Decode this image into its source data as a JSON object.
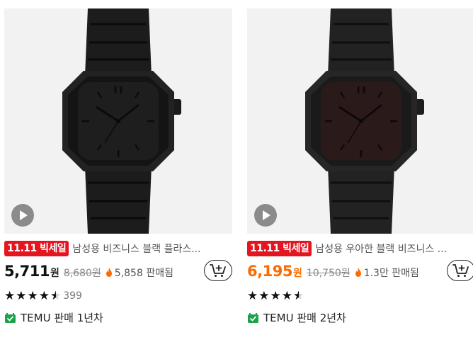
{
  "products": [
    {
      "badge": "11.11 빅세일",
      "title": "남성용 비즈니스 블랙 플라스...",
      "price": "5,711",
      "price_unit": "원",
      "original_price": "8,680원",
      "sold": "5,858 판매됨",
      "rating": "★★★★",
      "reviews": "399",
      "seller": "TEMU 판매 1년차",
      "price_color": "#111111"
    },
    {
      "badge": "11.11 빅세일",
      "title": "남성용 우아한 블랙 비즈니스 ...",
      "price": "6,195",
      "price_unit": "원",
      "original_price": "10,750원",
      "sold": "1.3만 판매됨",
      "rating": "★★★★",
      "reviews": "",
      "seller": "TEMU 판매 2년차",
      "price_color": "#fb6b00"
    }
  ],
  "icons": {
    "play": "play-icon",
    "cart": "add-to-cart-icon",
    "fire": "fire-icon",
    "seller": "store-icon"
  },
  "colors": {
    "badge": "#e4151f",
    "accent": "#fb6b00",
    "seller_icon": "#1aa34a"
  }
}
